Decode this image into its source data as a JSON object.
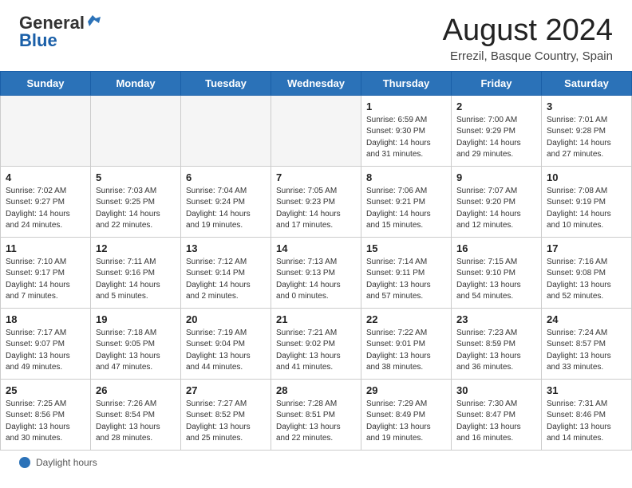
{
  "header": {
    "logo_general": "General",
    "logo_blue": "Blue",
    "month_title": "August 2024",
    "location": "Errezil, Basque Country, Spain"
  },
  "days_of_week": [
    "Sunday",
    "Monday",
    "Tuesday",
    "Wednesday",
    "Thursday",
    "Friday",
    "Saturday"
  ],
  "weeks": [
    [
      {
        "day": "",
        "empty": true
      },
      {
        "day": "",
        "empty": true
      },
      {
        "day": "",
        "empty": true
      },
      {
        "day": "",
        "empty": true
      },
      {
        "day": "1",
        "info": "Sunrise: 6:59 AM\nSunset: 9:30 PM\nDaylight: 14 hours\nand 31 minutes."
      },
      {
        "day": "2",
        "info": "Sunrise: 7:00 AM\nSunset: 9:29 PM\nDaylight: 14 hours\nand 29 minutes."
      },
      {
        "day": "3",
        "info": "Sunrise: 7:01 AM\nSunset: 9:28 PM\nDaylight: 14 hours\nand 27 minutes."
      }
    ],
    [
      {
        "day": "4",
        "info": "Sunrise: 7:02 AM\nSunset: 9:27 PM\nDaylight: 14 hours\nand 24 minutes."
      },
      {
        "day": "5",
        "info": "Sunrise: 7:03 AM\nSunset: 9:25 PM\nDaylight: 14 hours\nand 22 minutes."
      },
      {
        "day": "6",
        "info": "Sunrise: 7:04 AM\nSunset: 9:24 PM\nDaylight: 14 hours\nand 19 minutes."
      },
      {
        "day": "7",
        "info": "Sunrise: 7:05 AM\nSunset: 9:23 PM\nDaylight: 14 hours\nand 17 minutes."
      },
      {
        "day": "8",
        "info": "Sunrise: 7:06 AM\nSunset: 9:21 PM\nDaylight: 14 hours\nand 15 minutes."
      },
      {
        "day": "9",
        "info": "Sunrise: 7:07 AM\nSunset: 9:20 PM\nDaylight: 14 hours\nand 12 minutes."
      },
      {
        "day": "10",
        "info": "Sunrise: 7:08 AM\nSunset: 9:19 PM\nDaylight: 14 hours\nand 10 minutes."
      }
    ],
    [
      {
        "day": "11",
        "info": "Sunrise: 7:10 AM\nSunset: 9:17 PM\nDaylight: 14 hours\nand 7 minutes."
      },
      {
        "day": "12",
        "info": "Sunrise: 7:11 AM\nSunset: 9:16 PM\nDaylight: 14 hours\nand 5 minutes."
      },
      {
        "day": "13",
        "info": "Sunrise: 7:12 AM\nSunset: 9:14 PM\nDaylight: 14 hours\nand 2 minutes."
      },
      {
        "day": "14",
        "info": "Sunrise: 7:13 AM\nSunset: 9:13 PM\nDaylight: 14 hours\nand 0 minutes."
      },
      {
        "day": "15",
        "info": "Sunrise: 7:14 AM\nSunset: 9:11 PM\nDaylight: 13 hours\nand 57 minutes."
      },
      {
        "day": "16",
        "info": "Sunrise: 7:15 AM\nSunset: 9:10 PM\nDaylight: 13 hours\nand 54 minutes."
      },
      {
        "day": "17",
        "info": "Sunrise: 7:16 AM\nSunset: 9:08 PM\nDaylight: 13 hours\nand 52 minutes."
      }
    ],
    [
      {
        "day": "18",
        "info": "Sunrise: 7:17 AM\nSunset: 9:07 PM\nDaylight: 13 hours\nand 49 minutes."
      },
      {
        "day": "19",
        "info": "Sunrise: 7:18 AM\nSunset: 9:05 PM\nDaylight: 13 hours\nand 47 minutes."
      },
      {
        "day": "20",
        "info": "Sunrise: 7:19 AM\nSunset: 9:04 PM\nDaylight: 13 hours\nand 44 minutes."
      },
      {
        "day": "21",
        "info": "Sunrise: 7:21 AM\nSunset: 9:02 PM\nDaylight: 13 hours\nand 41 minutes."
      },
      {
        "day": "22",
        "info": "Sunrise: 7:22 AM\nSunset: 9:01 PM\nDaylight: 13 hours\nand 38 minutes."
      },
      {
        "day": "23",
        "info": "Sunrise: 7:23 AM\nSunset: 8:59 PM\nDaylight: 13 hours\nand 36 minutes."
      },
      {
        "day": "24",
        "info": "Sunrise: 7:24 AM\nSunset: 8:57 PM\nDaylight: 13 hours\nand 33 minutes."
      }
    ],
    [
      {
        "day": "25",
        "info": "Sunrise: 7:25 AM\nSunset: 8:56 PM\nDaylight: 13 hours\nand 30 minutes."
      },
      {
        "day": "26",
        "info": "Sunrise: 7:26 AM\nSunset: 8:54 PM\nDaylight: 13 hours\nand 28 minutes."
      },
      {
        "day": "27",
        "info": "Sunrise: 7:27 AM\nSunset: 8:52 PM\nDaylight: 13 hours\nand 25 minutes."
      },
      {
        "day": "28",
        "info": "Sunrise: 7:28 AM\nSunset: 8:51 PM\nDaylight: 13 hours\nand 22 minutes."
      },
      {
        "day": "29",
        "info": "Sunrise: 7:29 AM\nSunset: 8:49 PM\nDaylight: 13 hours\nand 19 minutes."
      },
      {
        "day": "30",
        "info": "Sunrise: 7:30 AM\nSunset: 8:47 PM\nDaylight: 13 hours\nand 16 minutes."
      },
      {
        "day": "31",
        "info": "Sunrise: 7:31 AM\nSunset: 8:46 PM\nDaylight: 13 hours\nand 14 minutes."
      }
    ]
  ],
  "footer": {
    "daylight_label": "Daylight hours"
  }
}
